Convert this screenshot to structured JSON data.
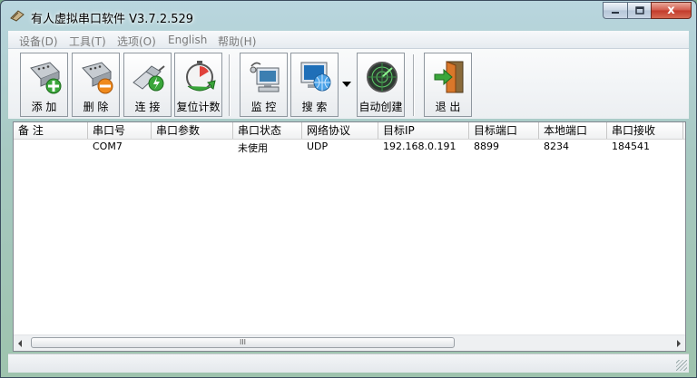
{
  "window": {
    "title": "有人虚拟串口软件 V3.7.2.529",
    "min_icon": "minimize-icon",
    "max_icon": "maximize-icon",
    "close_icon": "close-icon",
    "close_glyph": "x"
  },
  "menu": [
    {
      "id": "device",
      "label": "设备(D)"
    },
    {
      "id": "tools",
      "label": "工具(T)"
    },
    {
      "id": "options",
      "label": "选项(O)"
    },
    {
      "id": "english",
      "label": "English"
    },
    {
      "id": "help",
      "label": "帮助(H)"
    }
  ],
  "toolbar": {
    "add": {
      "label": "添 加",
      "icon": "serial-port-add-icon"
    },
    "delete": {
      "label": "删 除",
      "icon": "serial-port-delete-icon"
    },
    "connect": {
      "label": "连 接",
      "icon": "connect-cable-icon"
    },
    "reset_count": {
      "label": "复位计数",
      "icon": "reset-clock-icon"
    },
    "monitor": {
      "label": "监 控",
      "icon": "monitor-computer-icon"
    },
    "search": {
      "label": "搜 索",
      "icon": "search-globe-icon"
    },
    "auto_create": {
      "label": "自动创建",
      "icon": "radar-icon"
    },
    "exit": {
      "label": "退 出",
      "icon": "exit-door-icon"
    }
  },
  "table": {
    "columns": [
      "备 注",
      "串口号",
      "串口参数",
      "串口状态",
      "网络协议",
      "目标IP",
      "目标端口",
      "本地端口",
      "串口接收"
    ],
    "rows": [
      {
        "remark": "",
        "port": "COM7",
        "params": "",
        "status": "未使用",
        "protocol": "UDP",
        "target_ip": "192.168.0.191",
        "target_port": "8899",
        "local_port": "8234",
        "received": "184541"
      }
    ],
    "scroll_thumb_grip": "III"
  },
  "colors": {
    "accent": "#3c7fb1",
    "close_red": "#c2392a"
  }
}
